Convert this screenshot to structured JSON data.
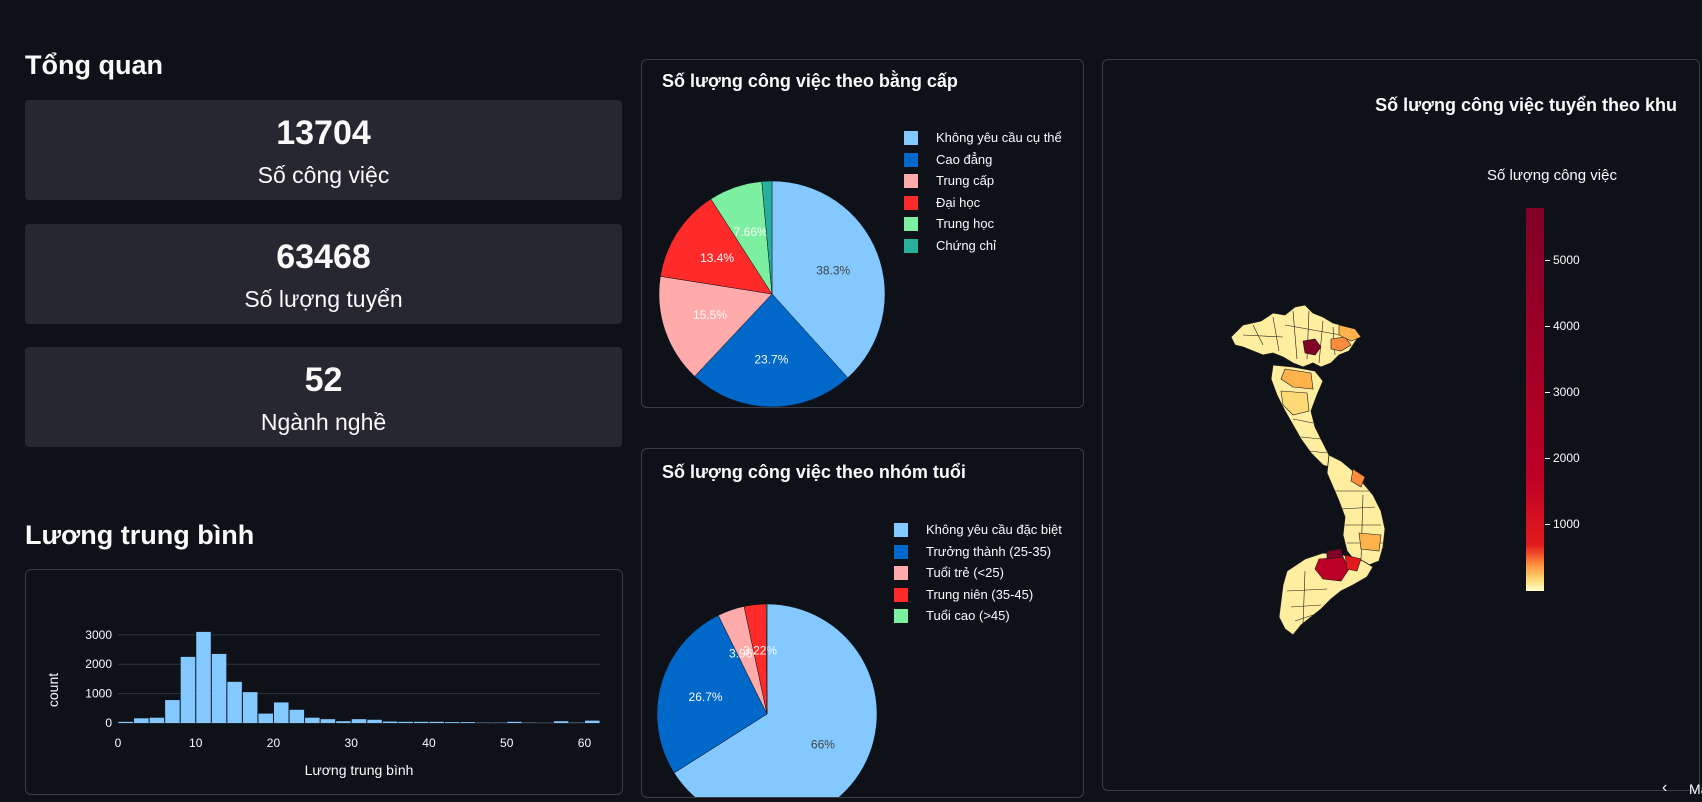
{
  "overview": {
    "title": "Tổng quan",
    "metrics": [
      {
        "value": "13704",
        "label": "Số công việc"
      },
      {
        "value": "63468",
        "label": "Số lượng tuyển"
      },
      {
        "value": "52",
        "label": "Ngành nghề"
      }
    ]
  },
  "salary": {
    "title": "Lương trung bình"
  },
  "degree_chart_title": "Số lượng công việc theo bằng cấp",
  "age_chart_title": "Số lượng công việc theo nhóm tuổi",
  "map": {
    "title": "Số lượng công việc tuyển theo khu",
    "colorbar_title": "Số lượng công việc",
    "colorbar_ticks": [
      "5000",
      "4000",
      "3000",
      "2000",
      "1000"
    ],
    "colorbar_range": [
      0,
      5800
    ],
    "colors": [
      "#ffffcc",
      "#fed976",
      "#fd8d3c",
      "#e31a1c",
      "#bd0026",
      "#800026"
    ]
  },
  "nav": {
    "label": "Ma"
  },
  "chart_data": [
    {
      "type": "pie",
      "title": "Số lượng công việc theo bằng cấp",
      "labels": [
        "Không yêu cầu cụ thể",
        "Cao đẳng",
        "Trung cấp",
        "Đại học",
        "Trung học",
        "Chứng chỉ"
      ],
      "values": [
        38.3,
        23.7,
        15.5,
        13.4,
        7.66,
        1.44
      ],
      "display_labels": [
        "38.3%",
        "23.7%",
        "15.5%",
        "13.4%",
        "7.66%",
        ""
      ],
      "colors": [
        "#83c9ff",
        "#0068c9",
        "#ffabab",
        "#ff2b2b",
        "#7defa1",
        "#29b09d"
      ],
      "legend": "right"
    },
    {
      "type": "pie",
      "title": "Số lượng công việc theo nhóm tuổi",
      "labels": [
        "Không yêu cầu đặc biệt",
        "Trưởng thành (25-35)",
        "Tuổi trẻ (<25)",
        "Trung niên (35-45)",
        "Tuổi cao (>45)"
      ],
      "values": [
        66,
        26.7,
        3.96,
        3.22,
        0.12
      ],
      "display_labels": [
        "66%",
        "26.7%",
        "3.96%",
        "3.22%",
        ""
      ],
      "colors": [
        "#83c9ff",
        "#0068c9",
        "#ffabab",
        "#ff2b2b",
        "#7defa1"
      ],
      "legend": "right"
    },
    {
      "type": "bar",
      "subtype": "histogram",
      "xlabel": "Lương trung bình",
      "ylabel": "count",
      "xlim": [
        0,
        62
      ],
      "ylim": [
        0,
        3300
      ],
      "xticks": [
        "0",
        "10",
        "20",
        "30",
        "40",
        "50",
        "60"
      ],
      "yticks": [
        "0",
        "1000",
        "2000",
        "3000"
      ],
      "bin_width": 2,
      "x": [
        1,
        3,
        5,
        7,
        9,
        11,
        13,
        15,
        17,
        19,
        21,
        23,
        25,
        27,
        29,
        31,
        33,
        35,
        37,
        39,
        41,
        43,
        45,
        47,
        49,
        51,
        53,
        55,
        57,
        59,
        61
      ],
      "values": [
        40,
        160,
        180,
        780,
        2250,
        3100,
        2350,
        1400,
        1050,
        320,
        700,
        450,
        180,
        130,
        60,
        130,
        110,
        50,
        40,
        40,
        40,
        30,
        30,
        10,
        10,
        40,
        10,
        5,
        60,
        10,
        80
      ],
      "color": "#83c9ff",
      "grid": true
    }
  ]
}
